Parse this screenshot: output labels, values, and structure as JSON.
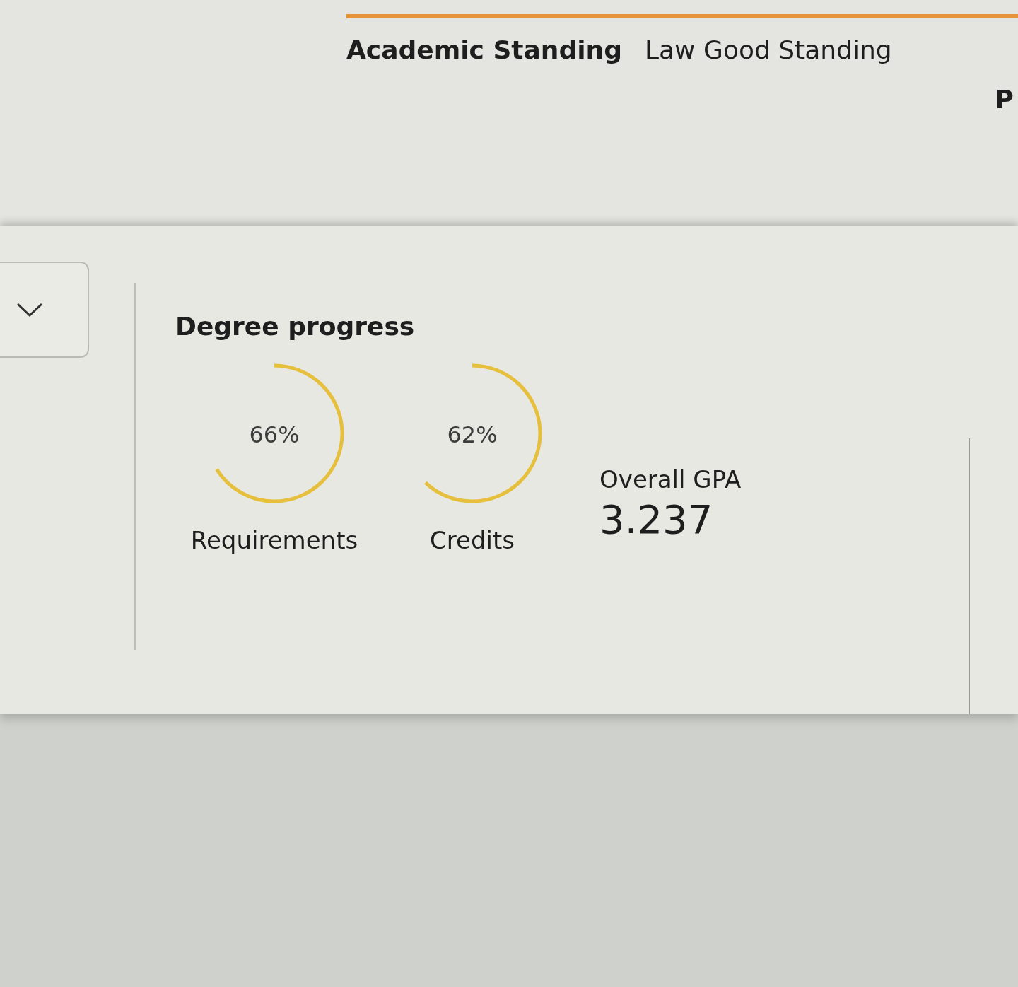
{
  "standing_bar": {
    "title": "Academic Standing",
    "status": "Law Good Standing",
    "next_item": "P"
  },
  "degree_progress": {
    "title": "Degree progress",
    "rings": [
      {
        "reading": "66%",
        "level": 0.66,
        "label": "Requirements"
      },
      {
        "reading": "62%",
        "level": 0.62,
        "label": "Credits"
      }
    ],
    "gpa": {
      "label": "Overall GPA",
      "value": "3.237"
    }
  }
}
